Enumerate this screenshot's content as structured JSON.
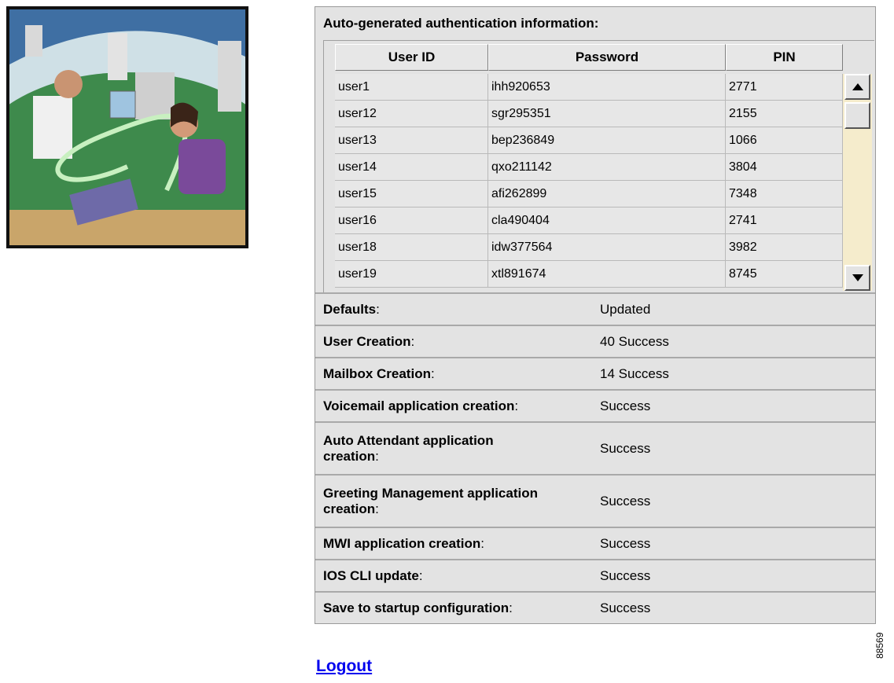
{
  "auth": {
    "title": "Auto-generated authentication information:",
    "columns": [
      "User ID",
      "Password",
      "PIN"
    ],
    "rows": [
      [
        "user1",
        "ihh920653",
        "2771"
      ],
      [
        "user12",
        "sgr295351",
        "2155"
      ],
      [
        "user13",
        "bep236849",
        "1066"
      ],
      [
        "user14",
        "qxo211142",
        "3804"
      ],
      [
        "user15",
        "afi262899",
        "7348"
      ],
      [
        "user16",
        "cla490404",
        "2741"
      ],
      [
        "user18",
        "idw377564",
        "3982"
      ],
      [
        "user19",
        "xtl891674",
        "8745"
      ]
    ]
  },
  "results": [
    {
      "label": "Defaults",
      "value": "Updated"
    },
    {
      "label": "User Creation",
      "value": "40 Success"
    },
    {
      "label": "Mailbox Creation",
      "value": "14 Success"
    },
    {
      "label": "Voicemail application creation",
      "value": "Success"
    },
    {
      "label": "Auto Attendant application creation",
      "value": "Success"
    },
    {
      "label": "Greeting Management application creation",
      "value": "Success"
    },
    {
      "label": "MWI application creation",
      "value": "Success"
    },
    {
      "label": "IOS CLI update",
      "value": "Success"
    },
    {
      "label": "Save to startup configuration",
      "value": "Success"
    }
  ],
  "logout_label": "Logout",
  "figure_id": "88569",
  "colors": {
    "link": "#0000ee",
    "panel": "#e3e3e3",
    "scroll_track": "#f5eccc"
  }
}
